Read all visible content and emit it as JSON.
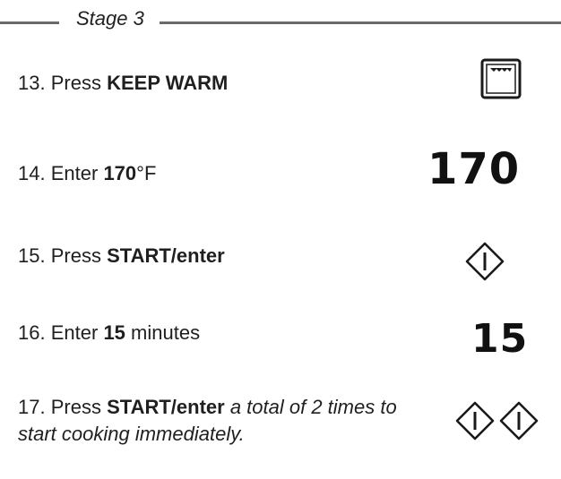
{
  "header": {
    "stage_title": "Stage 3"
  },
  "steps": [
    {
      "number": "13.",
      "verb": "Press",
      "bold": "KEEP WARM",
      "icon": "oven-keep-warm-icon"
    },
    {
      "number": "14.",
      "verb": "Enter",
      "bold": "170",
      "suffix": "°F",
      "display": "170"
    },
    {
      "number": "15.",
      "verb": "Press",
      "bold": "START/enter",
      "icon": "start-enter-icon"
    },
    {
      "number": "16.",
      "verb": "Enter",
      "bold": "15",
      "suffix": "minutes",
      "display": "15"
    },
    {
      "number": "17.",
      "verb": "Press",
      "bold": "START/enter",
      "italic": "a total of 2 times to start cooking immediately.",
      "icon": "start-enter-icon",
      "icon_count": 2
    }
  ],
  "colors": {
    "text": "#1f1f1f",
    "rule": "#6a6a6a"
  }
}
